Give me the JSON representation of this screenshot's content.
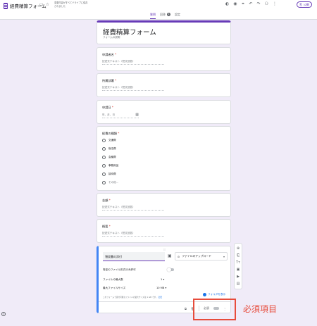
{
  "header": {
    "doc_title": "経費精算フォーム",
    "save_status": "変更内容がすべてドライブに保存されました",
    "publish_label": "公開"
  },
  "tabs": [
    {
      "label": "質問"
    },
    {
      "label": "回答",
      "badge": "1"
    },
    {
      "label": "設定"
    }
  ],
  "form": {
    "title": "経費精算フォーム",
    "description": "フォームの説明"
  },
  "questions": [
    {
      "label": "申請者名",
      "required": "*",
      "placeholder": "記述式テキスト（短文回答）"
    },
    {
      "label": "所属部署",
      "required": "*",
      "placeholder": "記述式テキスト（短文回答）"
    },
    {
      "label": "申請日",
      "required": "*",
      "placeholder": "年、月、日"
    },
    {
      "label": "経費の種類",
      "required": "*",
      "options": [
        "交通費",
        "宿泊費",
        "会議費",
        "事務用品",
        "接待費",
        "その他..."
      ]
    },
    {
      "label": "金額",
      "required": "*",
      "placeholder": "記述式テキスト（短文回答）"
    },
    {
      "label": "概要",
      "required": "*",
      "placeholder": "記述式テキスト（短文回答）"
    }
  ],
  "active_question": {
    "title": "領収書の添付",
    "type": "ファイルのアップロード",
    "setting_file_types": "特定のファイル形式のみ許可",
    "setting_max_files_label": "ファイルの最大数",
    "setting_max_files_value": "1",
    "setting_max_size_label": "最大ファイルサイズ",
    "setting_max_size_value": "10 MB",
    "note": "このフォームで受付可能なファイルの最大サイズは 1 GB です。",
    "note_link": "変更",
    "folder_link": "フォルダを表示",
    "required_label": "必須"
  },
  "callout": "必須項目"
}
